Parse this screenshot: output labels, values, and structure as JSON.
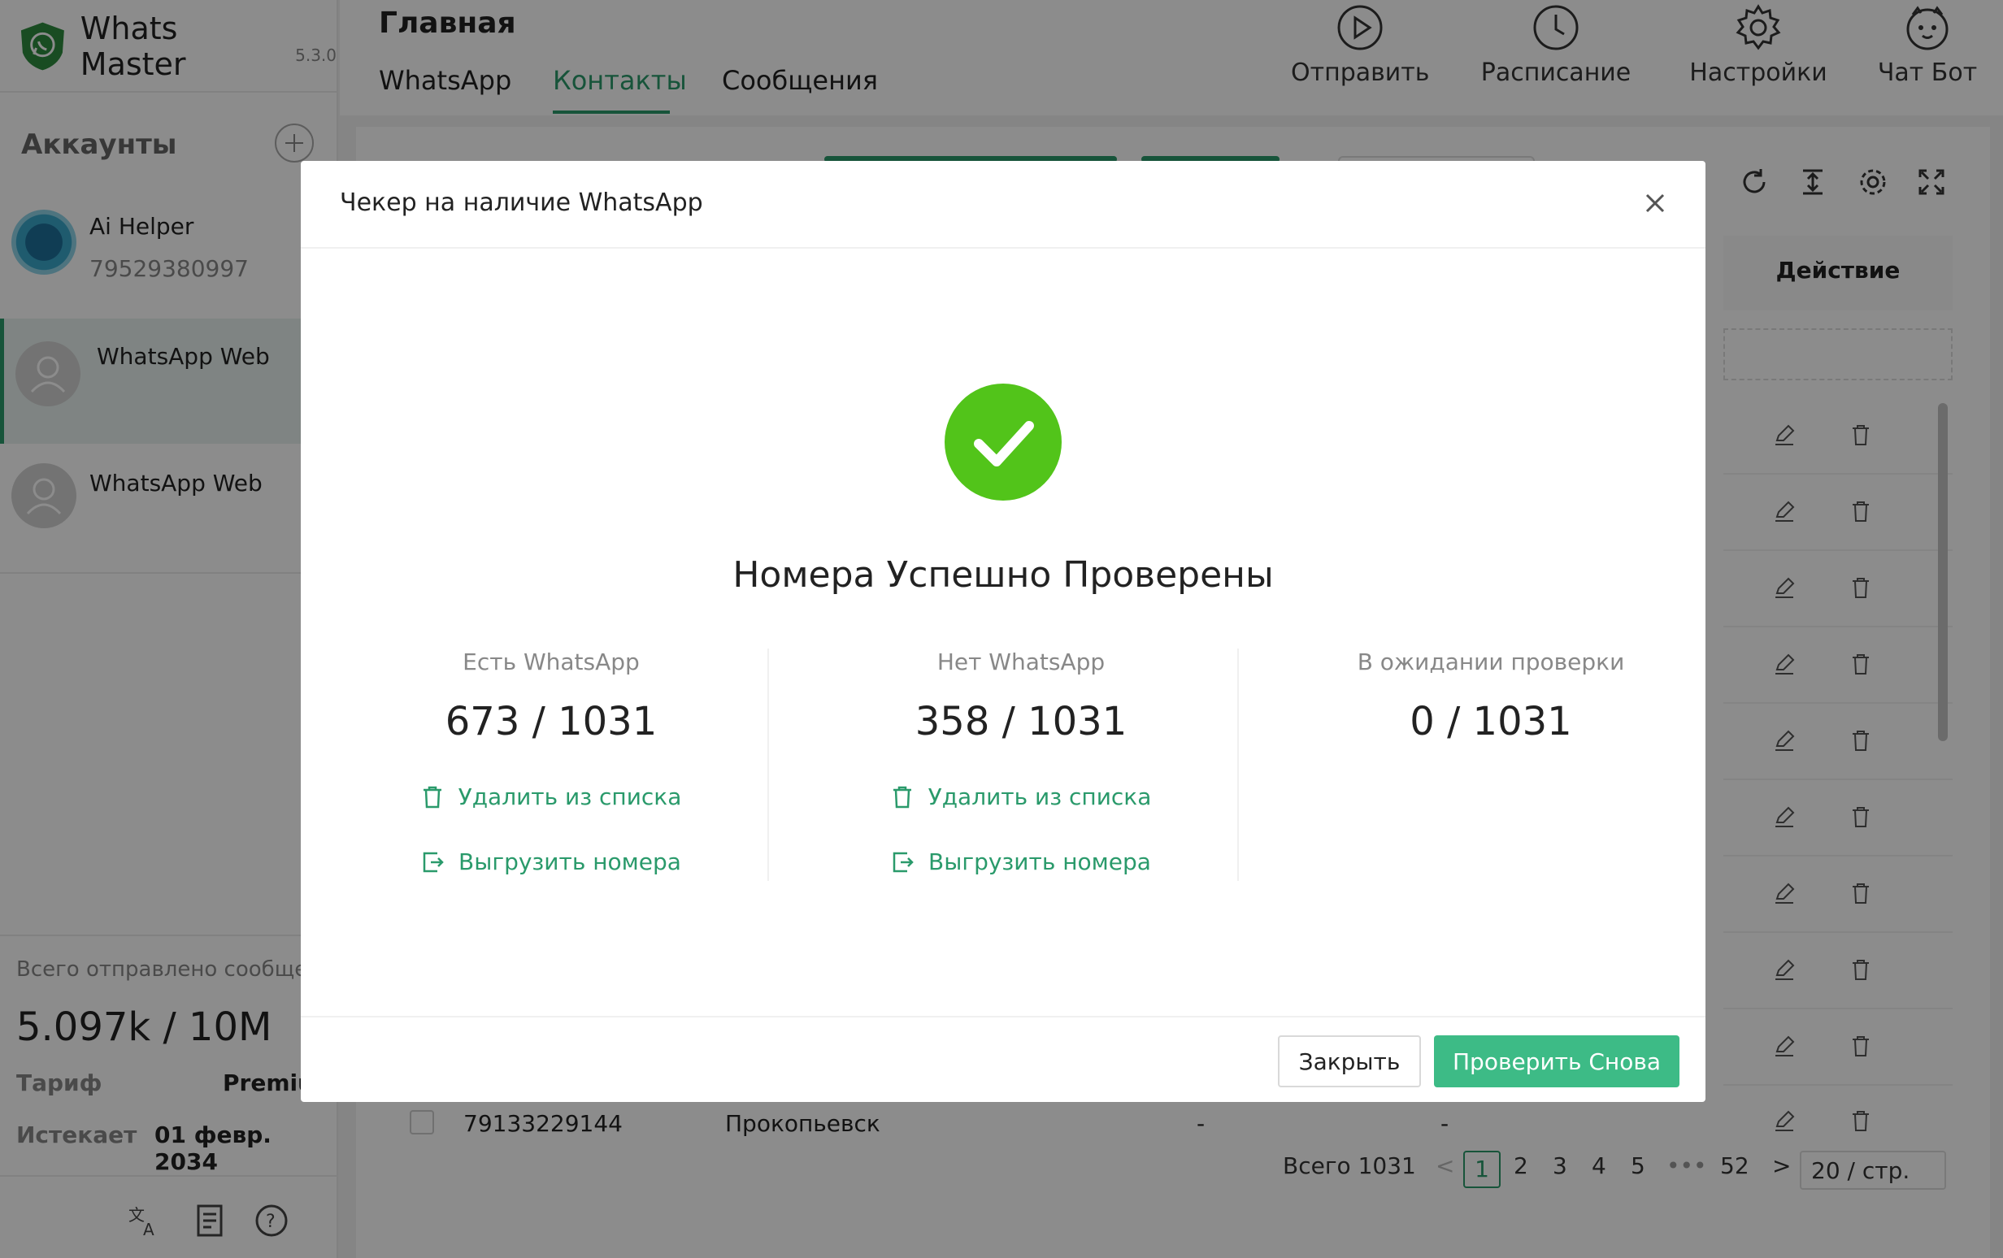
{
  "app": {
    "name": "Whats Master",
    "version": "5.3.0"
  },
  "sidebar": {
    "accounts_title": "Аккаунты",
    "accounts": [
      {
        "name": "Ai Helper",
        "phone": "79529380997"
      },
      {
        "name": "WhatsApp Web",
        "phone": ""
      },
      {
        "name": "WhatsApp Web",
        "phone": ""
      }
    ],
    "stats_label": "Всего отправлено сообще",
    "stats_value": "5.097k / 10M",
    "plan_label": "Тариф",
    "plan_value": "Premiu",
    "expires_label": "Истекает",
    "expires_value": "01 февр. 2034"
  },
  "header": {
    "title": "Главная",
    "tabs": [
      {
        "label": "WhatsApp"
      },
      {
        "label": "Контакты"
      },
      {
        "label": "Сообщения"
      }
    ],
    "active_tab": "Контакты",
    "tools": [
      {
        "label": "Отправить",
        "icon": "play-icon"
      },
      {
        "label": "Расписание",
        "icon": "clock-icon"
      },
      {
        "label": "Настройки",
        "icon": "gear-icon"
      },
      {
        "label": "Чат Бот",
        "icon": "bot-icon"
      }
    ]
  },
  "table": {
    "action_header": "Действие",
    "bottom_row": {
      "phone": "79133229144",
      "city": "Прокопьевск",
      "c3": "-",
      "c4": "-"
    }
  },
  "pagination": {
    "total": "Всего 1031",
    "pages": [
      "1",
      "2",
      "3",
      "4",
      "5",
      "52"
    ],
    "ellipsis": "•••",
    "current": "1",
    "page_size": "20 / стр.",
    "prev": "<",
    "next": ">"
  },
  "modal": {
    "title": "Чекер на наличие WhatsApp",
    "success_text": "Номера Успешно Проверены",
    "columns": [
      {
        "label": "Есть WhatsApp",
        "value": "673 / 1031",
        "delete_label": "Удалить из списка",
        "export_label": "Выгрузить номера"
      },
      {
        "label": "Нет WhatsApp",
        "value": "358 / 1031",
        "delete_label": "Удалить из списка",
        "export_label": "Выгрузить номера"
      },
      {
        "label": "В ожидании проверки",
        "value": "0 / 1031"
      }
    ],
    "close_label": "Закрыть",
    "retry_label": "Проверить Снова"
  },
  "colors": {
    "accent": "#2a9a6b",
    "success": "#52c41a",
    "primary_button": "#3dbb86"
  }
}
